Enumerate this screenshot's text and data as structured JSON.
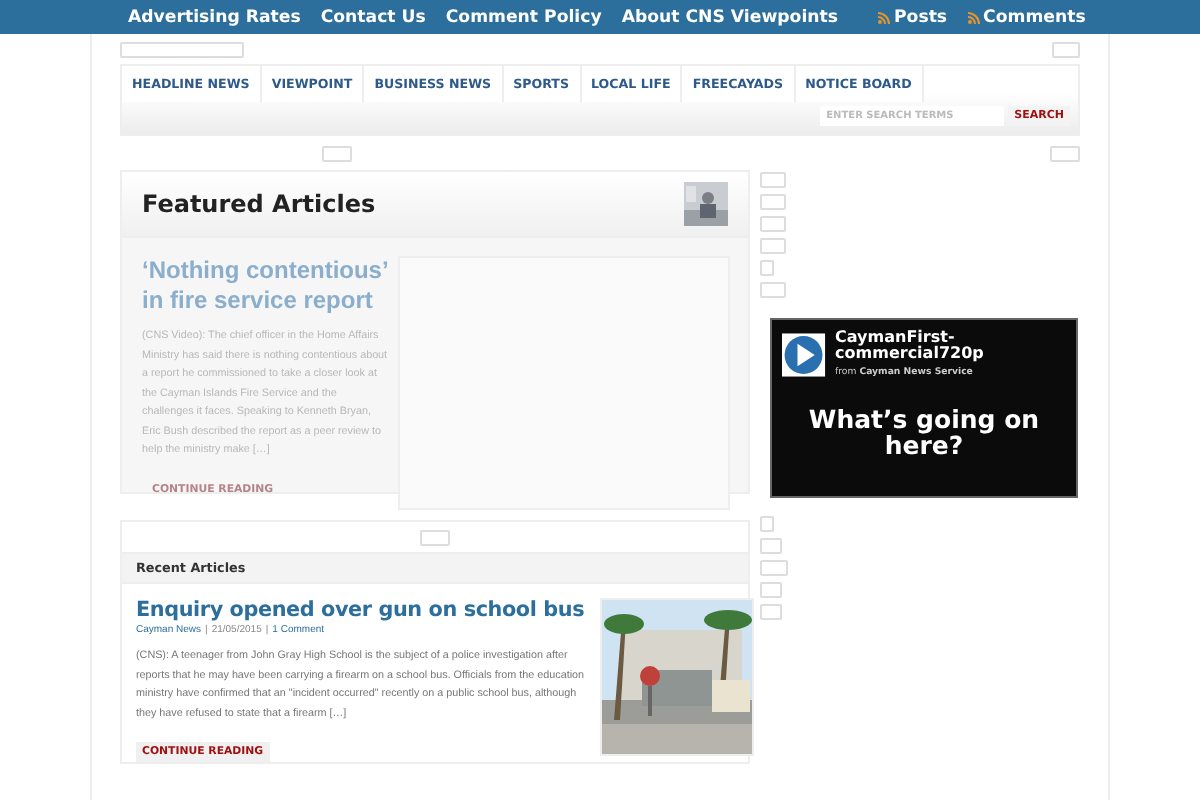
{
  "top_bar": {
    "links": [
      "Advertising Rates",
      "Contact Us",
      "Comment Policy",
      "About CNS Viewpoints"
    ],
    "feeds": [
      "Posts",
      "Comments"
    ]
  },
  "nav": {
    "tabs": [
      {
        "label": "HEADLINE NEWS",
        "selected": false
      },
      {
        "label": "VIEWPOINT",
        "selected": false
      },
      {
        "label": "BUSINESS NEWS",
        "selected": false
      },
      {
        "label": "SPORTS",
        "selected": false
      },
      {
        "label": "LOCAL LIFE",
        "selected": false
      },
      {
        "label": "FREECAYADS",
        "selected": false
      },
      {
        "label": "NOTICE BOARD",
        "selected": false
      }
    ],
    "search": {
      "placeholder": "ENTER SEARCH TERMS",
      "button": "SEARCH"
    }
  },
  "featured": {
    "heading": "Featured Articles",
    "article": {
      "title": "‘Nothing contentious’ in fire service report",
      "excerpt": "(CNS Video): The chief officer in the Home Affairs Ministry has said there is nothing contentious about a report he commissioned to take a closer look at the Cayman Islands Fire Service and the challenges it faces. Speaking to Kenneth Bryan, Eric Bush described the report as a peer review to help the ministry make […]",
      "more": "CONTINUE READING"
    }
  },
  "recent": {
    "heading": "Recent Articles",
    "article": {
      "title": "Enquiry opened over gun on school bus",
      "category": "Cayman News",
      "date": "21/05/2015",
      "separator": "|",
      "comments": "1 Comment",
      "excerpt": "(CNS): A teenager from John Gray High School is the subject of a police investigation after reports that he may have been carrying a firearm on a school bus. Officials from the education ministry have confirmed that an \"incident occurred\" recently on a public school bus, although they have refused to state that a firearm […]",
      "more": "CONTINUE READING"
    }
  },
  "video": {
    "title": "CaymanFirst-commercial720p",
    "from": "from",
    "source": "Cayman News Service",
    "caption": "What’s going on here?"
  }
}
